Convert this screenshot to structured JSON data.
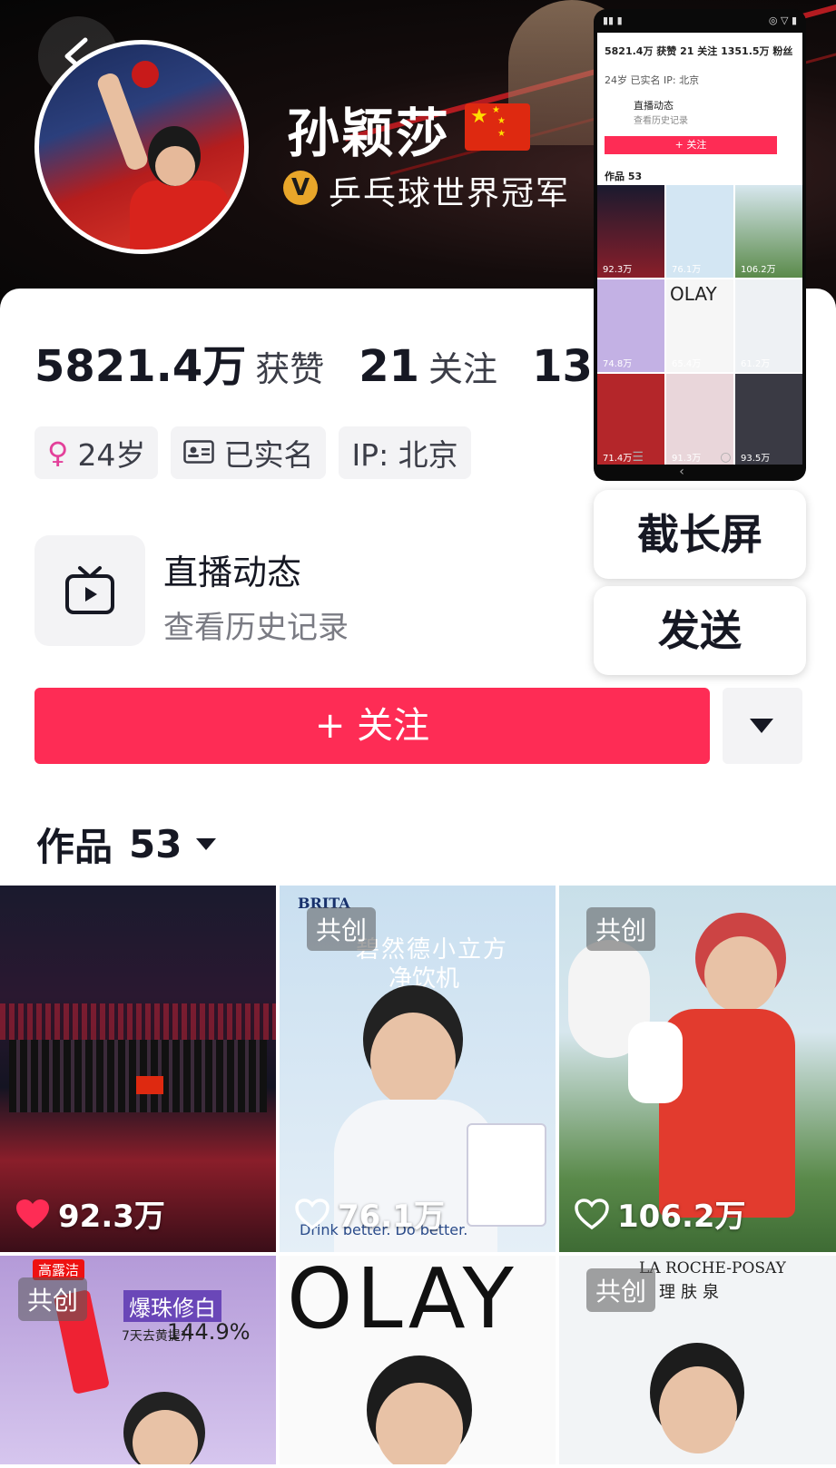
{
  "profile": {
    "name": "孙颖莎",
    "verification": "乒乓球世界冠军",
    "verify_mark": "V"
  },
  "stats": [
    {
      "value": "5821.4万",
      "label": "获赞"
    },
    {
      "value": "21",
      "label": "关注"
    },
    {
      "value": "135",
      "label": ""
    }
  ],
  "tags": {
    "age": "24岁",
    "realname": "已实名",
    "ip": "IP: 北京"
  },
  "live": {
    "title": "直播动态",
    "subtitle": "查看历史记录"
  },
  "follow_label": "+ 关注",
  "works": {
    "label": "作品",
    "count": "53"
  },
  "tiles": [
    {
      "badge": "",
      "likes": "92.3万",
      "liked": true
    },
    {
      "badge": "共创",
      "likes": "76.1万",
      "liked": false,
      "brand": "BRITA",
      "headline": "碧然德小立方",
      "headline2": "净饮机",
      "tagline": "Drink better. Do better."
    },
    {
      "badge": "共创",
      "likes": "106.2万",
      "liked": false
    },
    {
      "badge": "共创",
      "likes": "",
      "brand": "高露洁",
      "headline": "爆珠修白",
      "sub": "7天去黄提升",
      "percent": "144.9%"
    },
    {
      "badge": "",
      "likes": "",
      "brand": "OLAY"
    },
    {
      "badge": "共创",
      "likes": "",
      "brand": "LA ROCHE-POSAY",
      "brand_sub": "理肤泉"
    }
  ],
  "overlay": {
    "stats_text": "5821.4万 获赞  21 关注  1351.5万 粉丝",
    "tags_text": "24岁  已实名  IP: 北京",
    "live_title": "直播动态",
    "live_sub": "查看历史记录",
    "follow": "+ 关注",
    "works": "作品 53",
    "likes": [
      "92.3万",
      "76.1万",
      "106.2万",
      "74.8万",
      "65.4万",
      "61.2万",
      "71.4万",
      "91.3万",
      "93.5万"
    ],
    "olay": "OLAY",
    "nav": "☰ ○ ‹"
  },
  "actions": {
    "long_screenshot": "截长屏",
    "send": "发送"
  },
  "colors": {
    "accent": "#fe2c55",
    "verify": "#e8a62a"
  }
}
